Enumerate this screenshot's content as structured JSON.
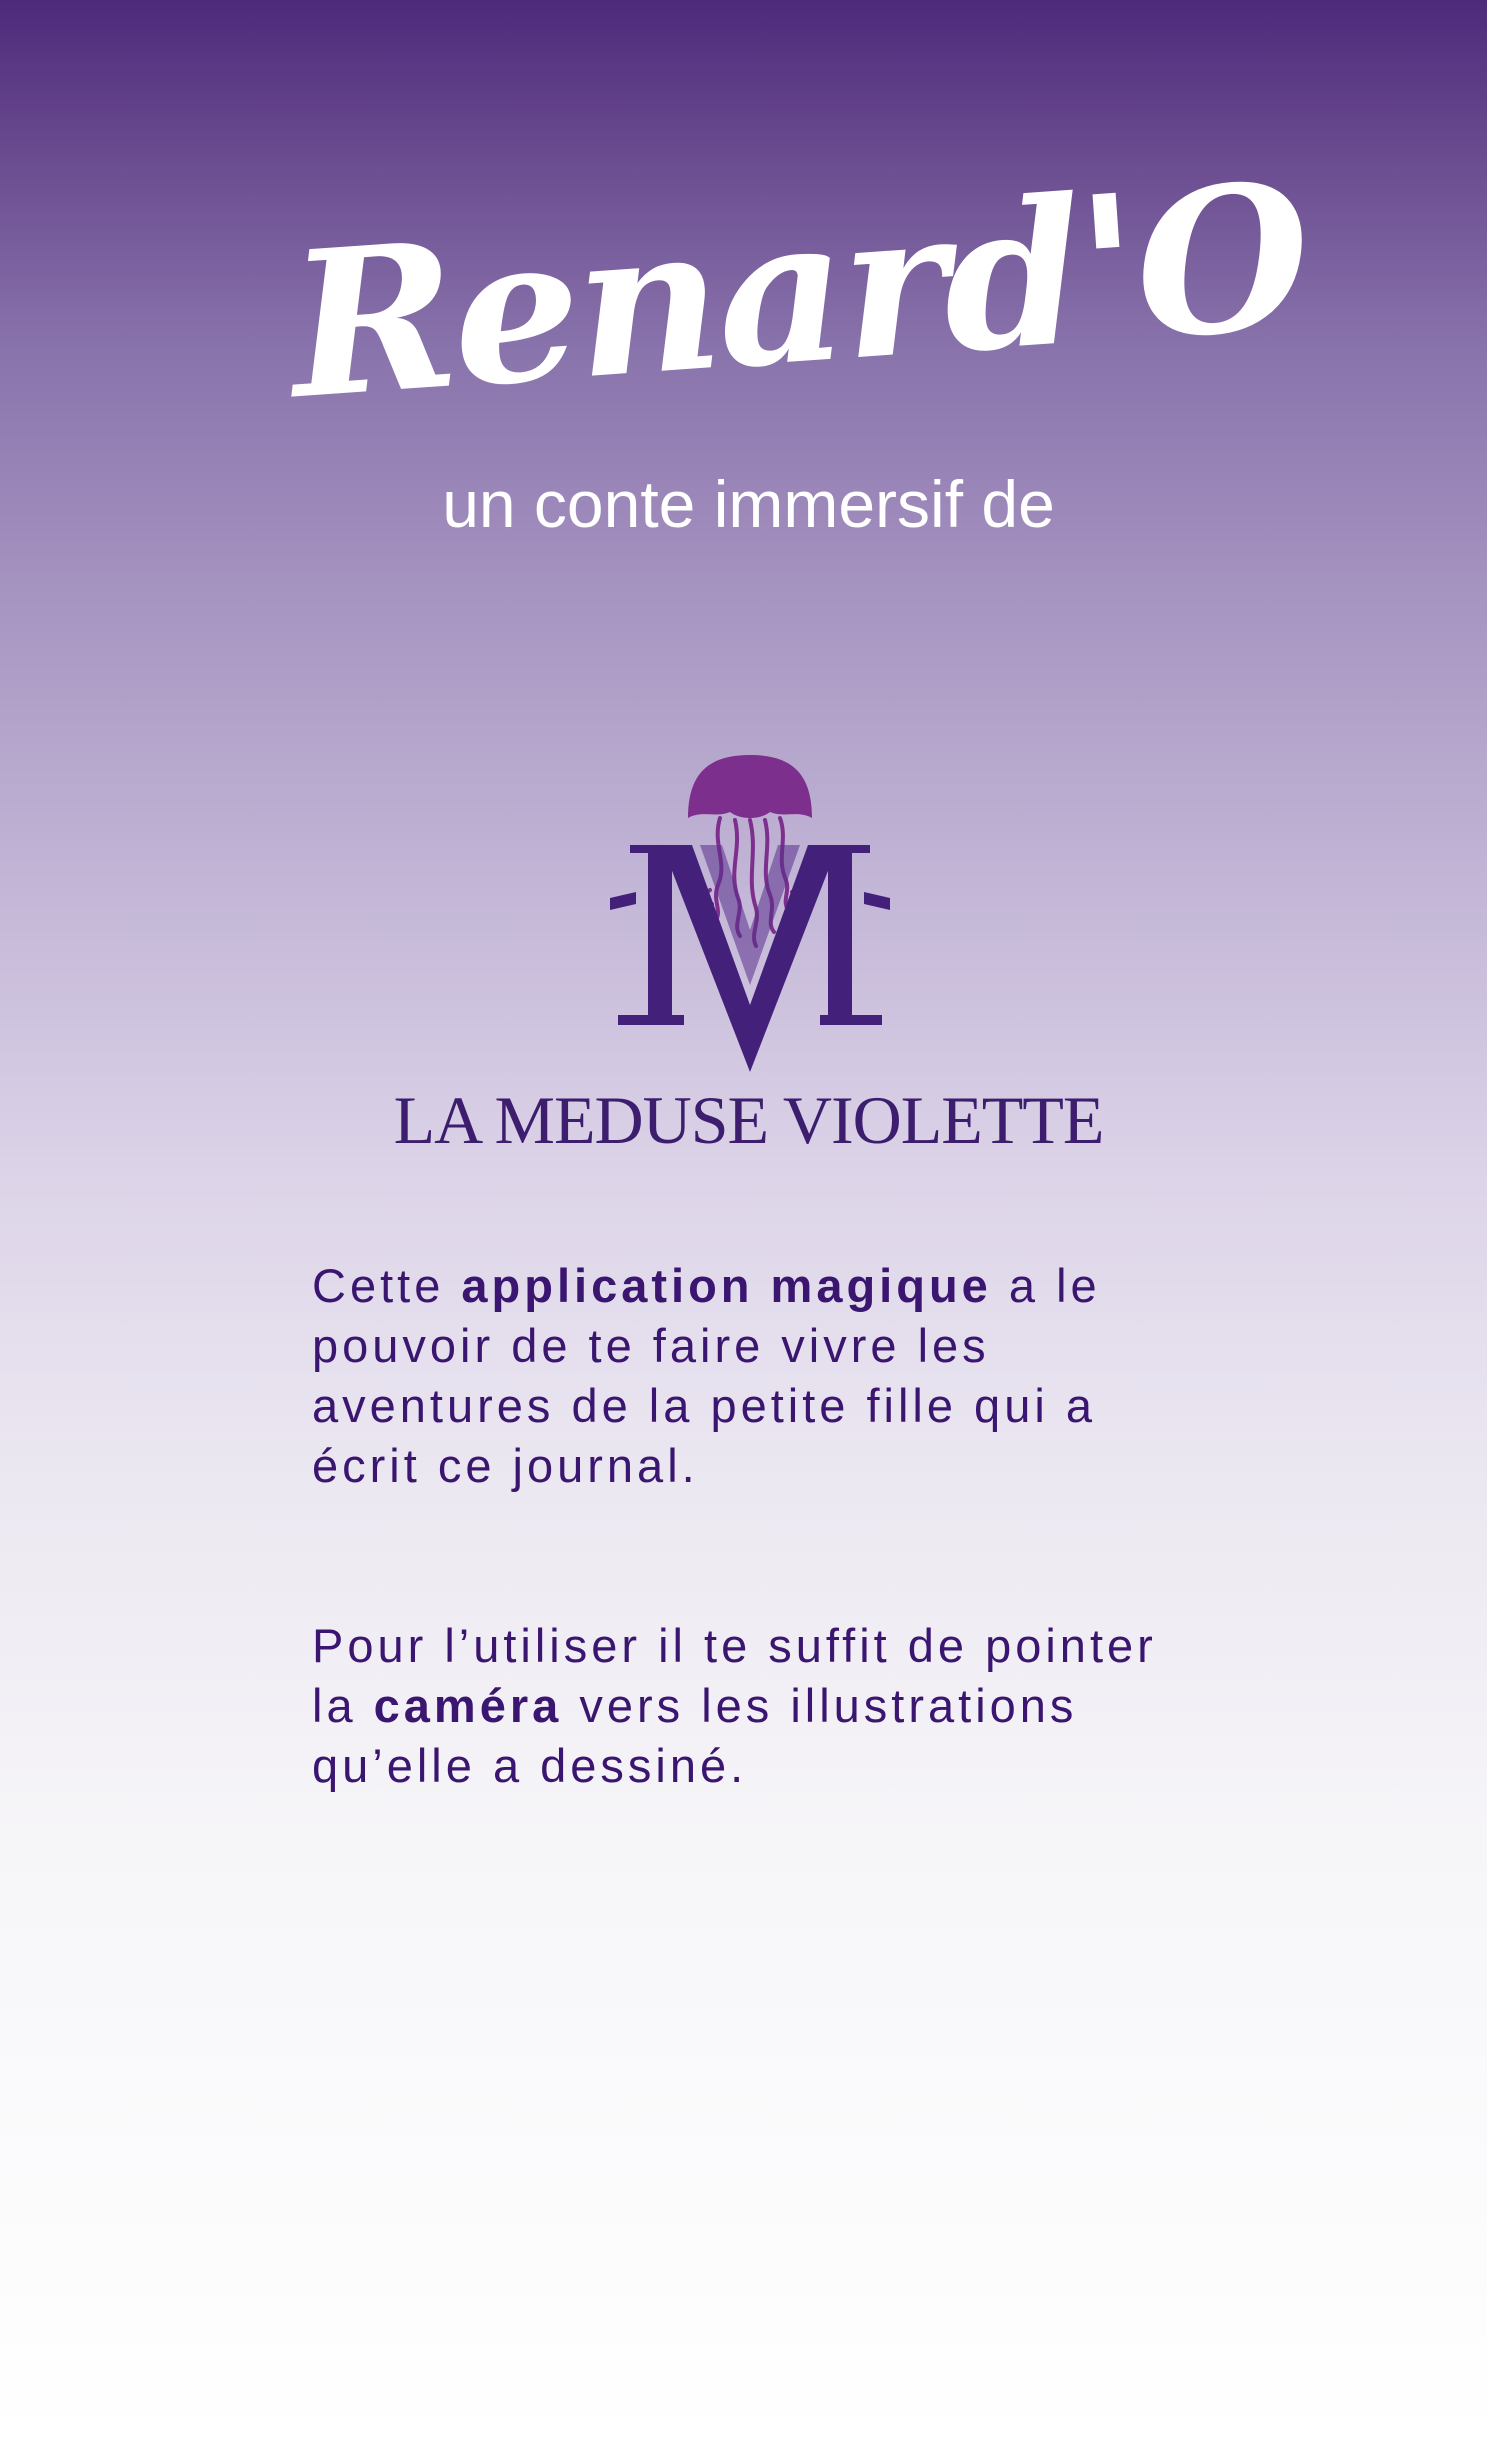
{
  "header": {
    "title": "Renard'O",
    "subtitle": "un conte immersif de"
  },
  "logo": {
    "brand_name": "LA MEDUSE VIOLETTE",
    "icon": "jellyfish-monogram-icon",
    "colors": {
      "jellyfish": "#7c2f8c",
      "monogram": "#43207a"
    }
  },
  "intro": {
    "p1_before": "Cette ",
    "p1_bold": "application magique",
    "p1_after": " a le pouvoir de te faire vivre les aventures de la petite fille qui a écrit ce journal.",
    "p2_before": "Pour l’utiliser il te suffit de pointer la ",
    "p2_bold": "caméra",
    "p2_after": " vers les illustrations qu’elle a dessiné."
  },
  "colors": {
    "gradient_top": "#4e2a7b",
    "gradient_bottom": "#ffffff",
    "text": "#3a1670",
    "title": "#ffffff"
  }
}
